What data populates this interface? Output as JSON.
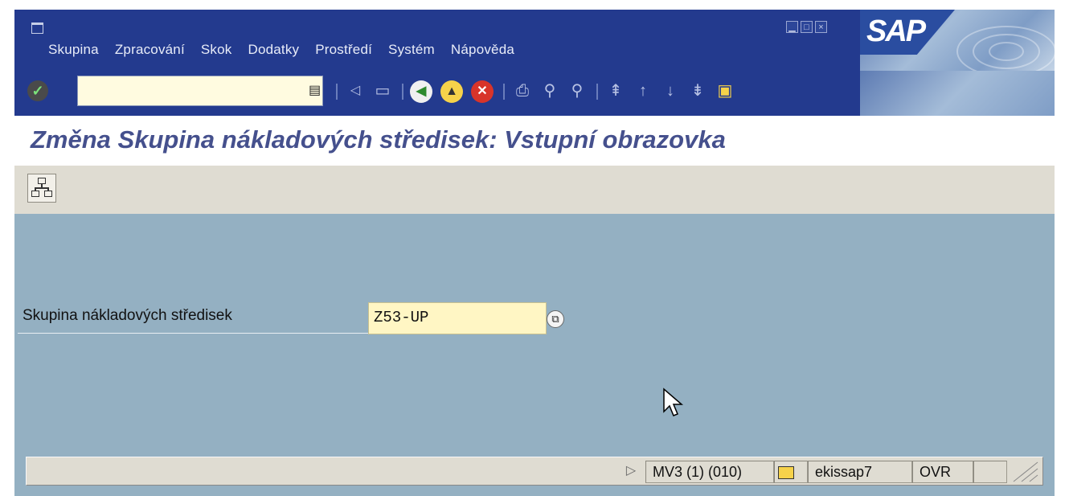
{
  "menubar": {
    "items": [
      "Skupina",
      "Zpracování",
      "Skok",
      "Dodatky",
      "Prostředí",
      "Systém",
      "Nápověda"
    ],
    "logo_text": "SAP"
  },
  "window_controls": [
    "minimize",
    "maximize",
    "close"
  ],
  "toolbar": {
    "command_field_value": "",
    "icons": [
      "enter-icon",
      "back-arrow-icon",
      "save-icon",
      "back-icon",
      "exit-icon",
      "cancel-icon",
      "print-icon",
      "find-icon",
      "find-next-icon",
      "first-page-icon",
      "previous-page-icon",
      "next-page-icon",
      "last-page-icon",
      "create-session-icon"
    ]
  },
  "title": "Změna Skupina nákladových středisek: Vstupní obrazovka",
  "app_toolbar": {
    "buttons": [
      "hierarchy-icon"
    ]
  },
  "form": {
    "field_label": "Skupina nákladových středisek",
    "field_value": "Z53-UP"
  },
  "statusbar": {
    "system": "MV3 (1) (010)",
    "server": "ekissap7",
    "mode": "OVR"
  },
  "colors": {
    "frame_blue": "#233a8e",
    "title_text": "#45508d",
    "main_bg": "#94b0c2",
    "toolbar_bg": "#dfdcd2",
    "input_bg": "#fff6c4"
  }
}
